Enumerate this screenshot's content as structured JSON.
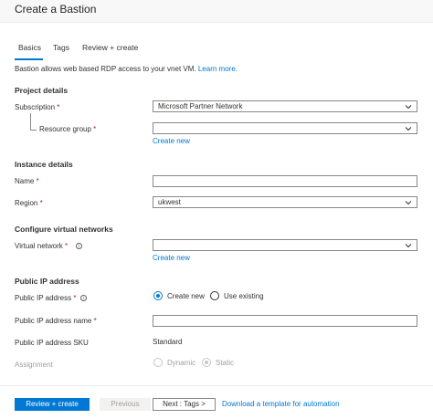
{
  "header": {
    "title": "Create a Bastion"
  },
  "tabs": [
    {
      "label": "Basics"
    },
    {
      "label": "Tags"
    },
    {
      "label": "Review + create"
    }
  ],
  "intro": {
    "text": "Bastion allows web based RDP access to your vnet VM.",
    "link": "Learn more."
  },
  "project": {
    "heading": "Project details",
    "subscription_label": "Subscription",
    "subscription_value": "Microsoft Partner Network",
    "resource_group_label": "Resource group",
    "resource_group_value": "",
    "create_new": "Create new"
  },
  "instance": {
    "heading": "Instance details",
    "name_label": "Name",
    "name_value": "",
    "region_label": "Region",
    "region_value": "ukwest"
  },
  "network": {
    "heading": "Configure virtual networks",
    "vnet_label": "Virtual network",
    "vnet_value": "",
    "create_new": "Create new"
  },
  "public_ip": {
    "heading": "Public IP address",
    "ip_label": "Public IP address",
    "option_create_new": "Create new",
    "option_use_existing": "Use existing",
    "selected": "Create new",
    "ip_name_label": "Public IP address name",
    "ip_name_value": "",
    "sku_label": "Public IP address SKU",
    "sku_value": "Standard",
    "assignment_label": "Assignment",
    "assignment_dynamic": "Dynamic",
    "assignment_static": "Static",
    "assignment_selected": "Static"
  },
  "required_marker": "*",
  "info_glyph": "i",
  "footer": {
    "review_create": "Review + create",
    "previous": "Previous",
    "next": "Next : Tags >",
    "download": "Download a template for automation"
  },
  "colors": {
    "accent": "#0078d4",
    "required": "#a4262c"
  }
}
